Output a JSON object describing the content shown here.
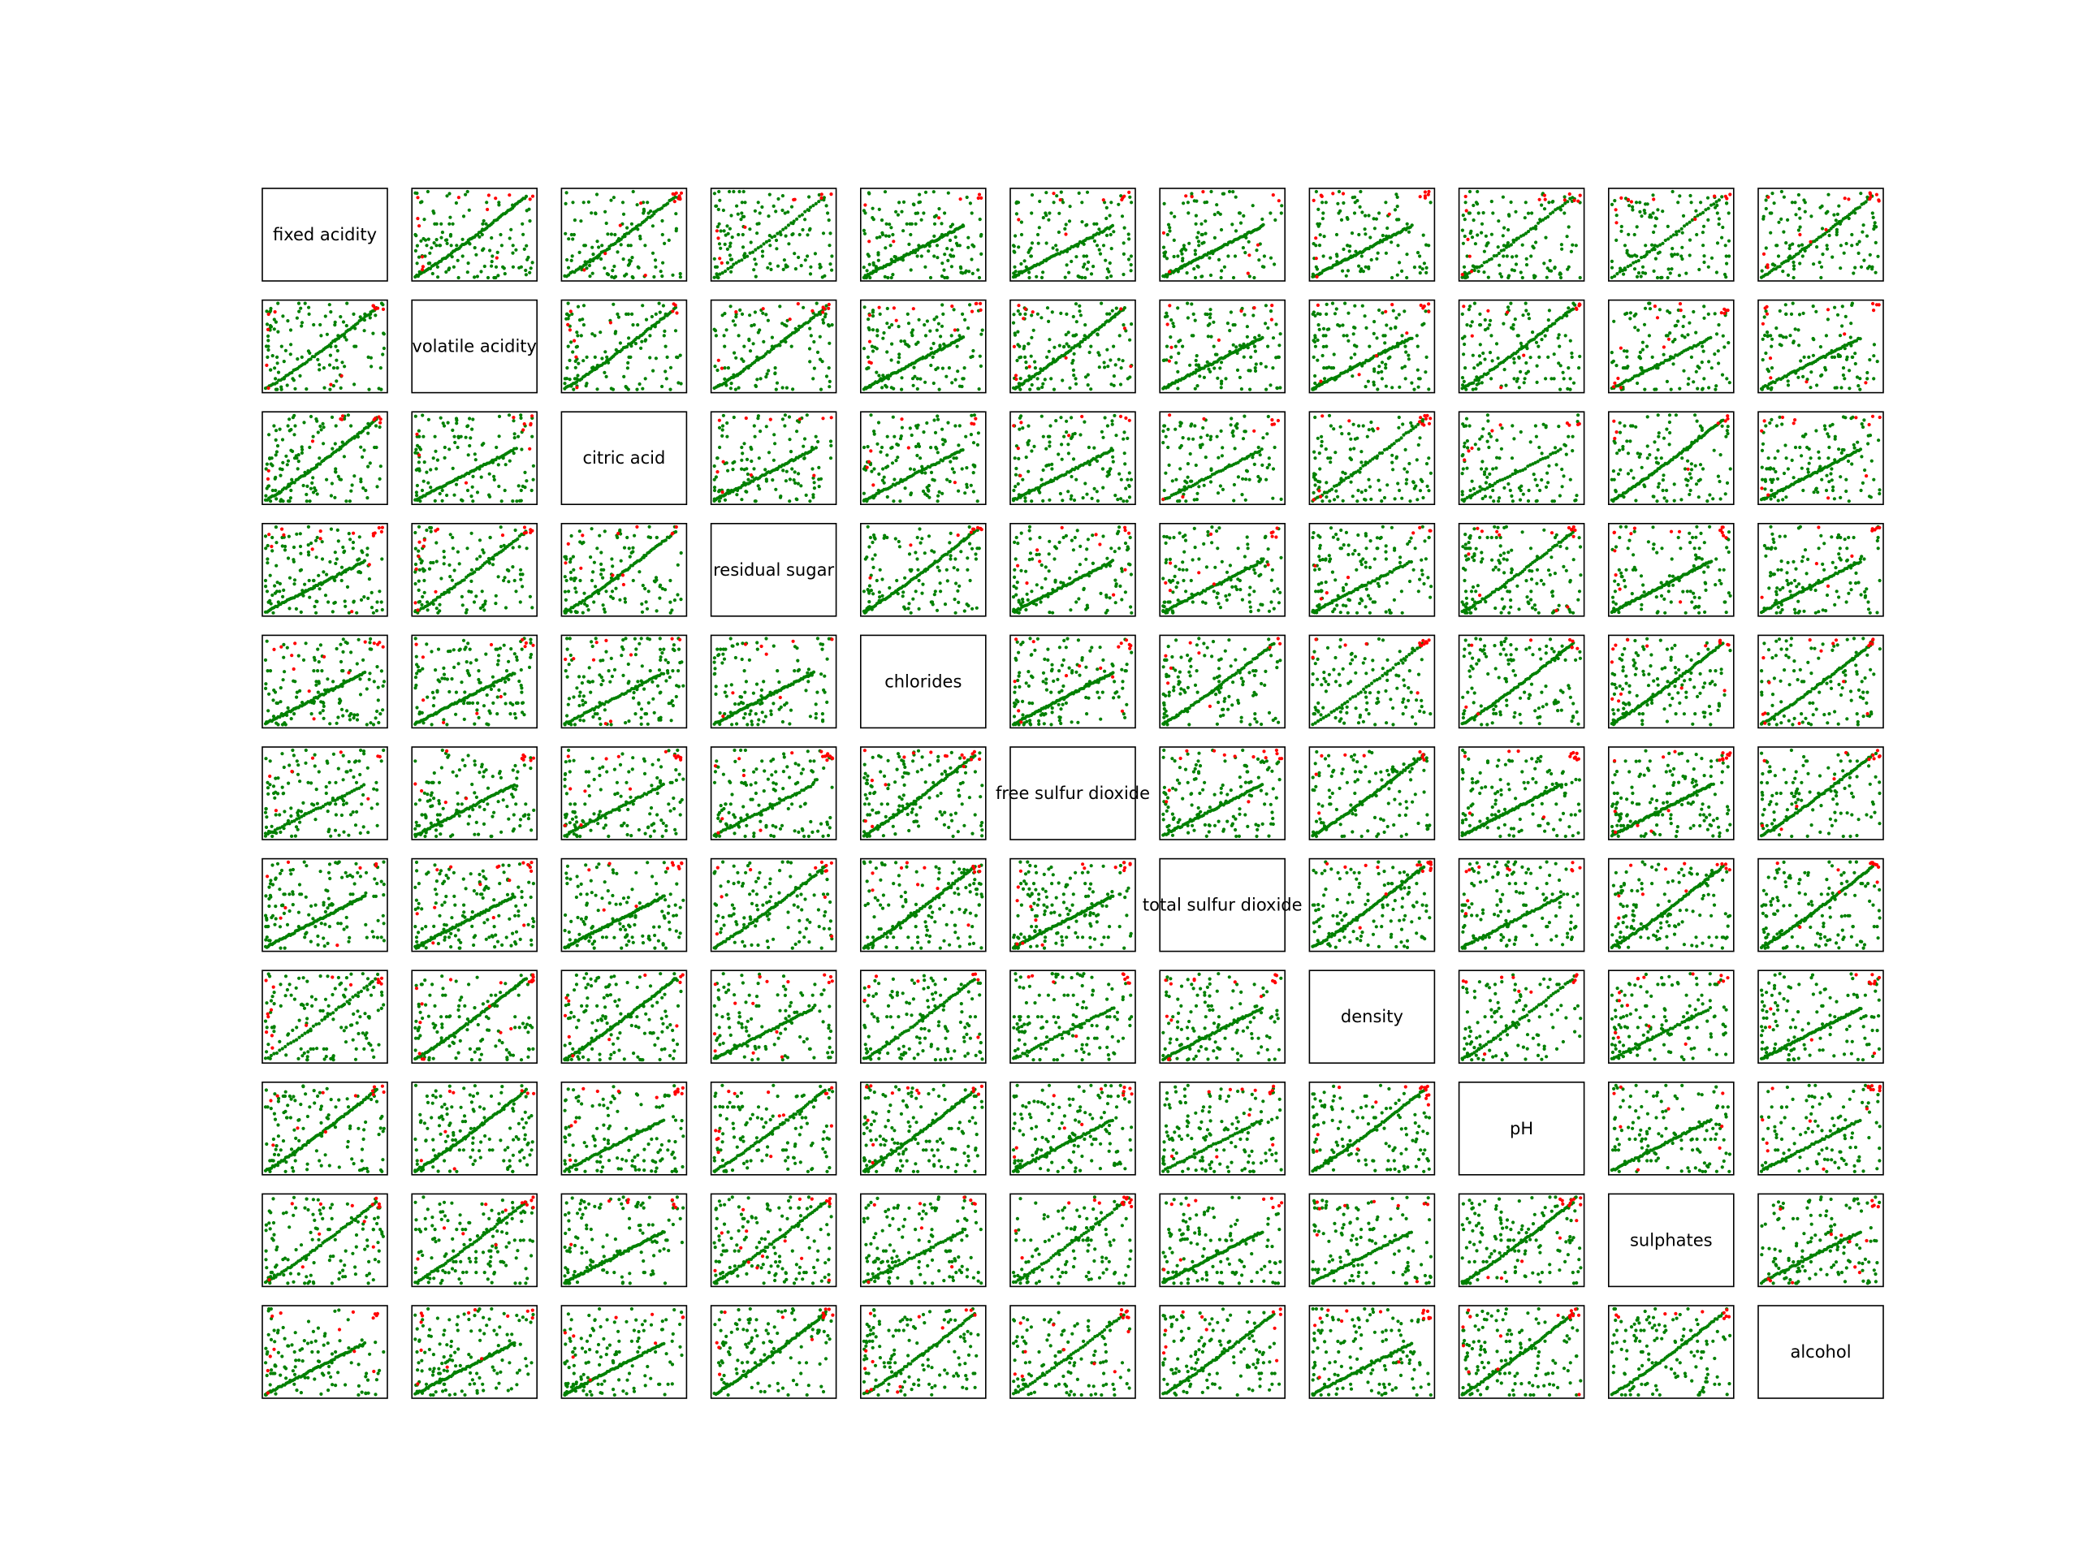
{
  "chart_data": {
    "type": "scatter",
    "variables": [
      "fixed acidity",
      "volatile acidity",
      "citric acid",
      "residual sugar",
      "chlorides",
      "free sulfur dioxide",
      "total sulfur dioxide",
      "density",
      "pH",
      "sulphates",
      "alcohol"
    ],
    "xlim": [
      0,
      1
    ],
    "ylim": [
      0,
      1
    ],
    "ticks": false,
    "grid": false,
    "series_colors": {
      "majority": "#008000",
      "outliers": "#ff0000"
    }
  }
}
